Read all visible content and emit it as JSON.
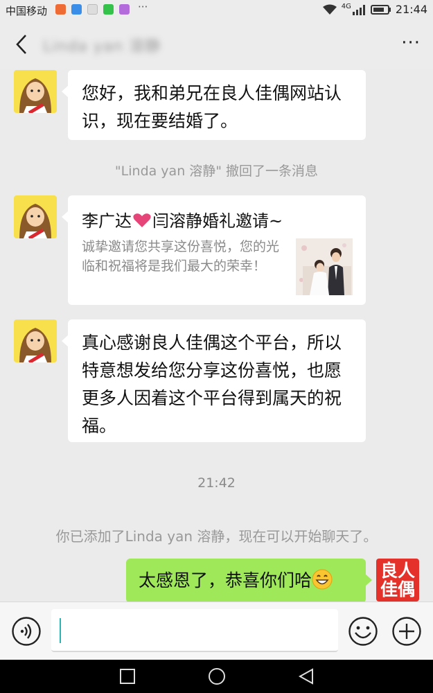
{
  "status_bar": {
    "carrier": "中国移动",
    "more": "···",
    "network": "4G",
    "time": "21:44"
  },
  "header": {
    "chat_title": "Linda yan 溶静",
    "more_label": "···"
  },
  "messages": {
    "m1": {
      "text": "您好，我和弟兄在良人佳偶网站认识，现在要结婚了。"
    },
    "recall_notice": "\"Linda yan 溶静\" 撤回了一条消息",
    "card": {
      "title_part1": "李广达",
      "title_part2": "闫溶静婚礼邀请~",
      "description": "诚挚邀请您共享这份喜悦，您的光临和祝福将是我们最大的荣幸！"
    },
    "m3": {
      "text": "真心感谢良人佳偶这个平台，所以特意想发给您分享这份喜悦，也愿更多人因着这个平台得到属天的祝福。"
    },
    "timestamp": "21:42",
    "added_notice": "你已添加了Linda yan 溶静，现在可以开始聊天了。",
    "reply": {
      "text": "太感恩了，恭喜你们哈"
    },
    "logo": {
      "line1": "良人",
      "line2": "佳偶"
    }
  },
  "input": {
    "value": "",
    "placeholder": ""
  },
  "icons": {
    "back": "chevron-left-icon",
    "voice": "voice-icon",
    "emoji": "emoji-icon",
    "plus": "plus-icon",
    "nav_recent": "square-icon",
    "nav_home": "circle-icon",
    "nav_back": "triangle-icon"
  },
  "colors": {
    "background": "#ebebeb",
    "bubble_incoming": "#ffffff",
    "bubble_outgoing": "#9fe85a",
    "logo": "#e4322b",
    "heart": "#e6457a"
  }
}
